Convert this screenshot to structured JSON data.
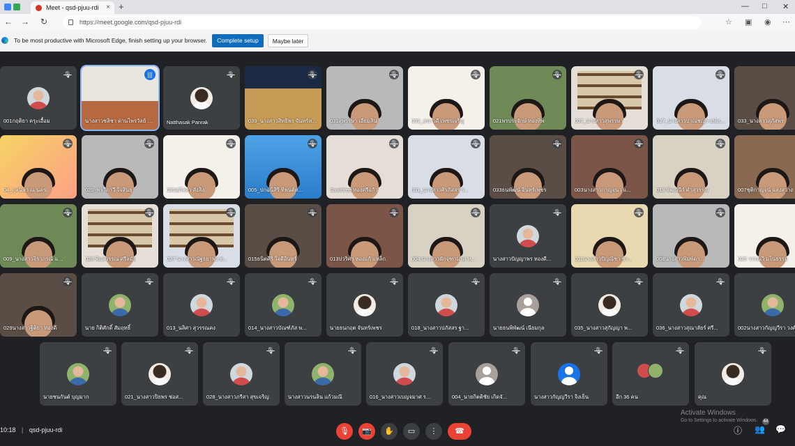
{
  "browser": {
    "tab_title": "Meet - qsd-pjuu-rdi",
    "tab_close": "×",
    "new_tab": "+",
    "url": "https://meet.google.com/qsd-pjuu-rdi",
    "infobar_text": "To be most productive with Microsoft Edge, finish setting up your browser.",
    "complete_setup": "Complete setup",
    "maybe_later": "Maybe later",
    "window_controls": [
      "—",
      "□",
      "✕"
    ],
    "nav": [
      "←",
      "→",
      "↻"
    ]
  },
  "participants": [
    [
      "001กฤติยา ครุะเอื้อม",
      "นางสาวชลิชา ด่านไพรวัลย์ ท...",
      "Natthasak Panrak",
      "039_นางสาวสิทธิพร จันทร์หอม",
      "031สุพรรษา เอี่ยมสิน",
      "032_ธนาวดี เพชรเจริญ",
      "021พรประจักษ์ ทองทิพ",
      "037_นางสาวสุพรรษา",
      "017_นางสาวปาณชญา แพ่งเมือง",
      "033_นางสาวสุภัสพร"
    ],
    [
      "04_กุลนิษา ณ นคร",
      "020_พรวิภาวี ใจสินธุ",
      "030อภิลลา ลังสิง",
      "005_ปกฉนิสิริ ทิพนต์ต...",
      "Sawittree ทองศรีแก้ว",
      "031_นางสาวศิรภัสสร ร...",
      "033ธนพัฒน์ อินทร์เพชร",
      "003นางสาวกาญจนา แ...",
      "018 พัฒนนีร์ คำสุวรรณ",
      "007ชุติกาญจน์ แสงสว่าง"
    ],
    [
      "009_นางสาวจิราภรณ์ แ...",
      "028 พิมลวรรณ ศรีลมัย",
      "027 นางสาวณัฐธยาพร ท...",
      "015ธนิตศิริ ใจดีอินทร์",
      "013ปวริศา ทองแก้วเหล็ก",
      "004 นางสาวผักจุฑามาศ ท...",
      "นางสาวปัญญาพร ทองดี...",
      "011นางสาวปัญณิชา ชา...",
      "008นางสาวพิมพ์ดา...",
      "025 วรรณวิ มโนธรรม"
    ],
    [
      "029นางสาวฐิติยา ทองดี",
      "นาย กิติศักดิ์ สัมฤทธิ์",
      "013_นลิศา สุวรรณคง",
      "014_นางสาวบัณฑ์ภัส พ...",
      "นายธนกฤต จันทร์เพชร",
      "018_นางสาวปภัสสร ฐา...",
      "นายธนพิพัฒน์ เนียมกุล",
      "035_นางสาวสุกัญญา พ...",
      "036_นางสาวสุณาลัยร์ ศรี...",
      "002นางสาวกัญญวีรา วงศ์ศรี"
    ],
    [
      "นายชนกันต์ บุญมาก",
      "021_นางสาวปิยพร ช่อส...",
      "028_นางสาวภรีสา สุขเจริญ",
      "นางสาวนรนลิน แก้วมณี",
      "016_นางสาวเบญจมาศ ร...",
      "004_นายกิตติชัย เกิดจั...",
      "นางสาวกัญญวีรา จิงเย็น",
      "อีก 36 คน",
      "คุณ"
    ]
  ],
  "controls": {
    "time": "10:18",
    "separator": "|",
    "meeting_code": "qsd-pjuu-rdi",
    "mic_icon": "🎙",
    "cam_icon": "📷",
    "hand_icon": "✋",
    "present_icon": "▭",
    "more_icon": "⋮",
    "leave_icon": "☎",
    "info_icon": "ⓘ",
    "people_icon": "👥",
    "people_badge": "44",
    "chat_icon": "💬"
  },
  "watermark": {
    "line1": "Activate Windows",
    "line2": "Go to Settings to activate Windows."
  },
  "colors": {
    "bg": "#202124",
    "tile": "#3c4043",
    "accent": "#1a73e8",
    "danger": "#ea4335"
  }
}
